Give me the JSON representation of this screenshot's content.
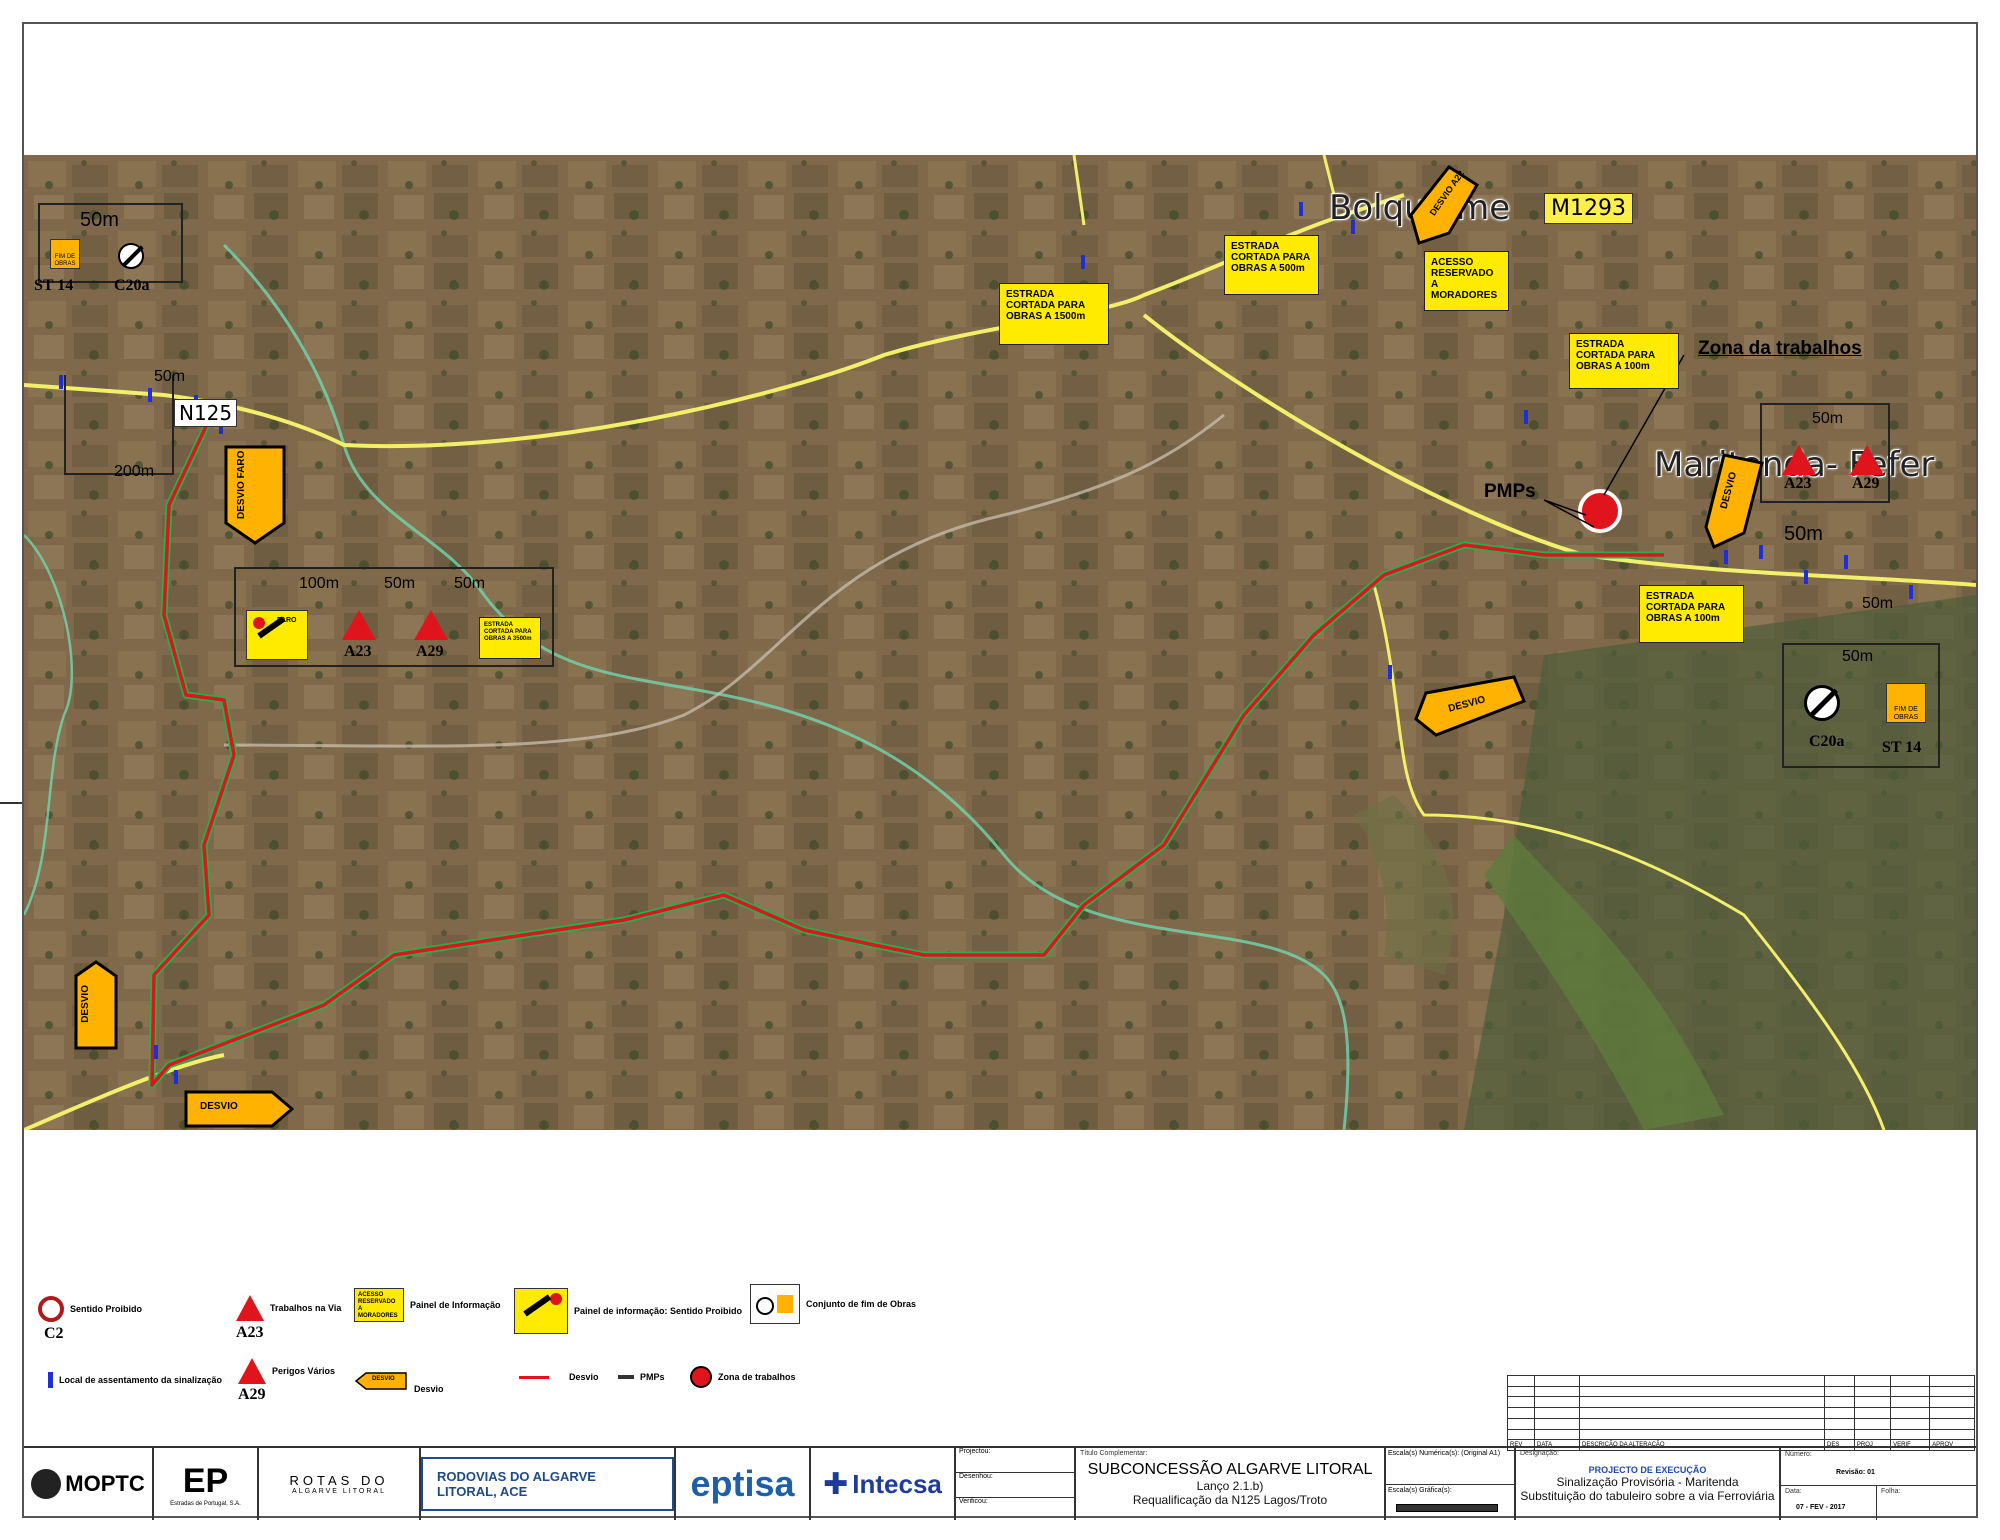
{
  "map": {
    "places": {
      "bolq": "Bolqueime",
      "marit": "Maritenda- Fefer",
      "m1293": "M1293",
      "n125": "N125"
    },
    "callouts": {
      "zona": "Zona da trabalhos",
      "pmps": "PMPs"
    },
    "dims": {
      "d50a": "50m",
      "d50b": "50m",
      "d200": "200m",
      "d100": "100m",
      "d50c": "50m",
      "d50d": "50m",
      "d50e": "50m",
      "d50f": "50m",
      "d50g": "50m",
      "d50h": "50m"
    },
    "sign_codes": {
      "st14": "ST 14",
      "c20a": "C20a",
      "a23": "A23",
      "a29": "A29",
      "a23b": "A23",
      "a29b": "A29",
      "c20a_b": "C20a",
      "st14_b": "ST 14",
      "fim": "FIM DE OBRAS",
      "faro": "FARO"
    },
    "panels": {
      "p1500": "ESTRADA CORTADA PARA OBRAS A 1500m",
      "p500": "ESTRADA CORTADA PARA OBRAS A 500m",
      "acesso": "ACESSO RESERVADO A MORADORES",
      "p100a": "ESTRADA CORTADA PARA OBRAS A 100m",
      "p100b": "ESTRADA CORTADA PARA OBRAS A 100m",
      "p3500": "ESTRADA CORTADA PARA OBRAS A 3500m"
    },
    "desvio": {
      "faro": "DESVIO FARO",
      "a22": "DESVIO A22",
      "d1": "DESVIO",
      "d2": "DESVIO",
      "d3": "DESVIO",
      "d4": "DESVIO"
    }
  },
  "legend": {
    "c2": "C2",
    "c2_label": "Sentido Proibido",
    "a23": "A23",
    "a23_label": "Trabalhos na Via",
    "panel_text": "ACESSO RESERVADO A MORADORES",
    "panel_label": "Painel de Informação",
    "prohib_label": "Painel de informação: Sentido Proibido",
    "fim_label": "Conjunto de fim de Obras",
    "local_label": "Local de assentamento da sinalização",
    "a29": "A29",
    "a29_label": "Perigos Vários",
    "desvio_sign": "DESVIO",
    "desvio_label": "Desvio",
    "red_label": "Desvio",
    "pmps_label": "PMPs",
    "zona_label": "Zona de trabalhos"
  },
  "revision_table": {
    "headers": [
      "REV",
      "DATA",
      "DESCRIÇÃO DA ALTERAÇÃO",
      "DES",
      "PROJ",
      "VERIF",
      "APROV"
    ]
  },
  "title_block": {
    "moptc": "MOPTC",
    "ep": "EP",
    "ep_sub": "Estradas de Portugal, S.A.",
    "rotas": "ROTAS DO",
    "rotas_sub": "ALGARVE LITORAL",
    "rodovias": "RODOVIAS DO ALGARVE LITORAL, ACE",
    "eptisa": "eptisa",
    "intecsa": "Intecsa",
    "projectou": "Projectou:",
    "desenhou": "Desenhou:",
    "verificou": "Verificou:",
    "titulo_label": "Título Complementar:",
    "titulo1": "SUBCONCESSÃO ALGARVE LITORAL",
    "titulo2": "Lanço 2.1.b)",
    "titulo3": "Requalificação da N125 Lagos/Troto",
    "escala_num": "Escala(s) Numérica(s):   (Original A1)",
    "escala_graf": "Escala(s) Gráfica(s):",
    "designacao_label": "Designação:",
    "designacao1": "PROJECTO DE EXECUÇÃO",
    "designacao2": "Sinalização Provisória - Maritenda",
    "designacao3": "Substituição do tabuleiro  sobre a via Ferroviária",
    "numero_label": "Número:",
    "revisao": "Revisão: 01",
    "data_label": "Data:",
    "data": "07 - FEV - 2017",
    "folha_label": "Folha:"
  },
  "colors": {
    "sign_yellow": "#ffeb00",
    "detour_red": "#e0141c",
    "detour_green": "#22b14c",
    "road_yellow": "#f2ef6a",
    "marker_blue": "#1f2fd6"
  }
}
